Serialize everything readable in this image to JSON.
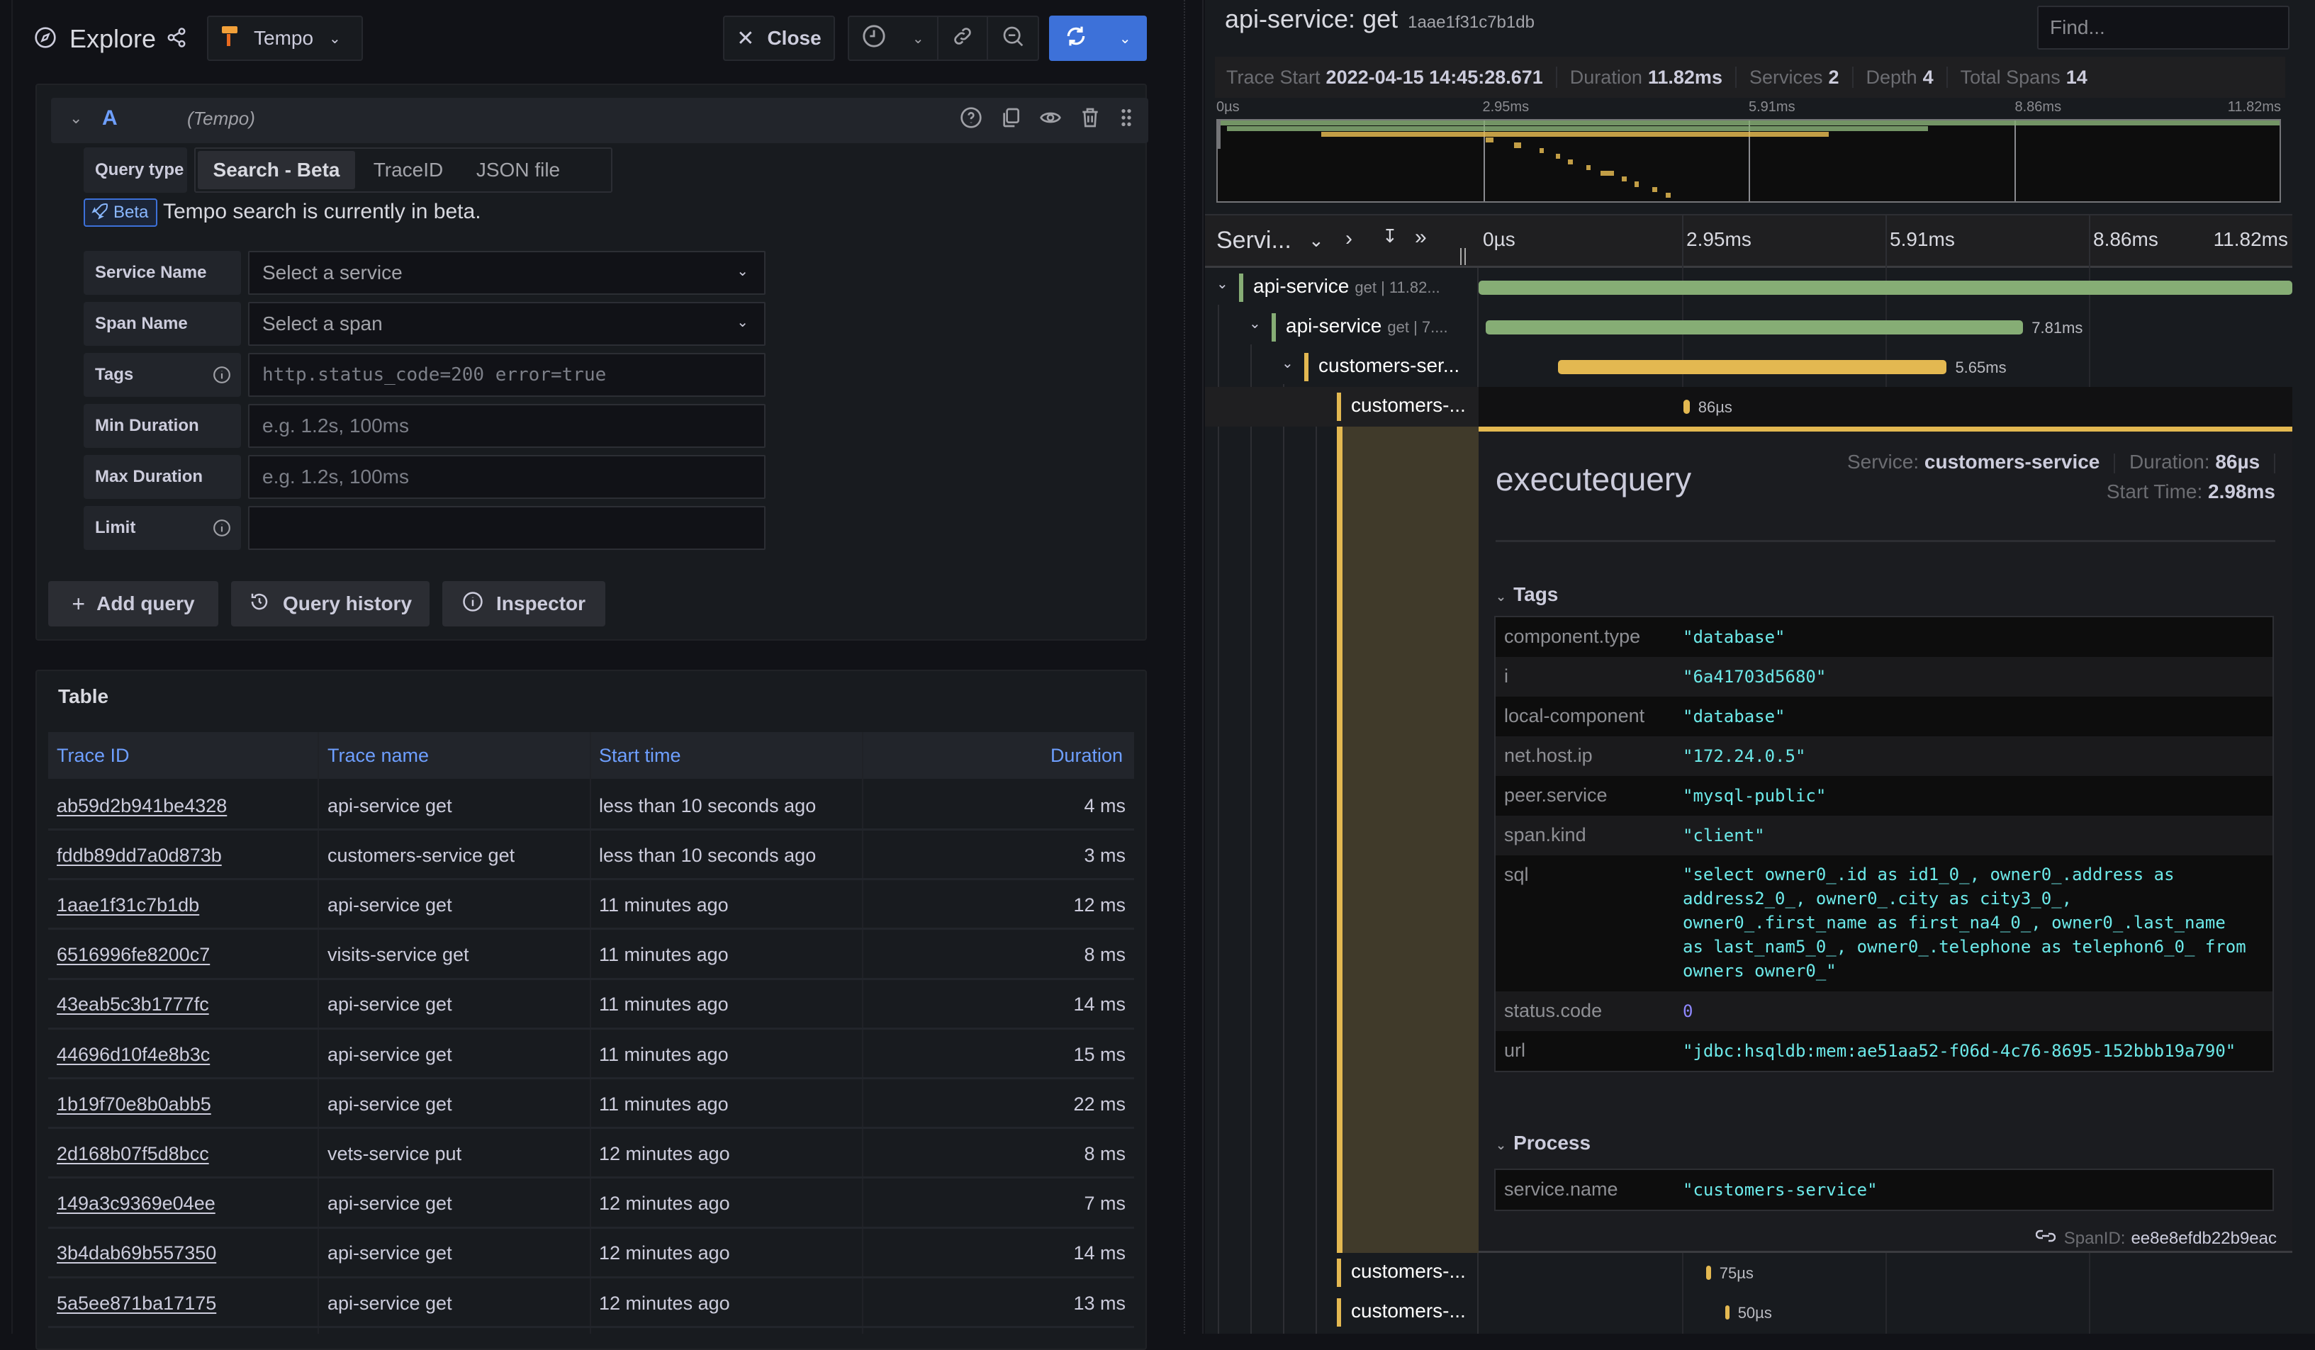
{
  "explore": {
    "title": "Explore",
    "datasource": "Tempo",
    "close_label": "Close",
    "icons": [
      "compass-icon",
      "share-icon",
      "tempo-logo-icon",
      "chevron-down-icon",
      "close-icon",
      "clock-icon",
      "link-icon",
      "zoom-out-icon",
      "refresh-icon"
    ]
  },
  "query": {
    "ref_id": "A",
    "datasource_hint": "(Tempo)",
    "query_type_label": "Query type",
    "query_types": [
      "Search - Beta",
      "TraceID",
      "JSON file"
    ],
    "selected_query_type": "Search - Beta",
    "beta_badge": "Beta",
    "beta_message": "Tempo search is currently in beta.",
    "fields": [
      {
        "label": "Service Name",
        "placeholder": "Select a service",
        "type": "select",
        "info": false
      },
      {
        "label": "Span Name",
        "placeholder": "Select a span",
        "type": "select",
        "info": false
      },
      {
        "label": "Tags",
        "placeholder": "http.status_code=200 error=true",
        "type": "text-mono",
        "info": true
      },
      {
        "label": "Min Duration",
        "placeholder": "e.g. 1.2s, 100ms",
        "type": "text",
        "info": false
      },
      {
        "label": "Max Duration",
        "placeholder": "e.g. 1.2s, 100ms",
        "type": "text",
        "info": false
      },
      {
        "label": "Limit",
        "placeholder": "",
        "type": "text",
        "info": true
      }
    ],
    "actions": [
      "Add query",
      "Query history",
      "Inspector"
    ]
  },
  "table": {
    "title": "Table",
    "columns": [
      "Trace ID",
      "Trace name",
      "Start time",
      "Duration"
    ],
    "rows": [
      [
        "ab59d2b941be4328",
        "api-service get",
        "less than 10 seconds ago",
        "4 ms"
      ],
      [
        "fddb89dd7a0d873b",
        "customers-service get",
        "less than 10 seconds ago",
        "3 ms"
      ],
      [
        "1aae1f31c7b1db",
        "api-service get",
        "11 minutes ago",
        "12 ms"
      ],
      [
        "6516996fe8200c7",
        "visits-service get",
        "11 minutes ago",
        "8 ms"
      ],
      [
        "43eab5c3b1777fc",
        "api-service get",
        "11 minutes ago",
        "14 ms"
      ],
      [
        "44696d10f4e8b3c",
        "api-service get",
        "11 minutes ago",
        "15 ms"
      ],
      [
        "1b19f70e8b0abb5",
        "api-service get",
        "11 minutes ago",
        "22 ms"
      ],
      [
        "2d168b07f5d8bcc",
        "vets-service put",
        "12 minutes ago",
        "8 ms"
      ],
      [
        "149a3c9369e04ee",
        "api-service get",
        "12 minutes ago",
        "7 ms"
      ],
      [
        "3b4dab69b557350",
        "api-service get",
        "12 minutes ago",
        "14 ms"
      ],
      [
        "5a5ee871ba17175",
        "api-service get",
        "12 minutes ago",
        "13 ms"
      ]
    ]
  },
  "trace": {
    "title": "api-service: get",
    "trace_id": "1aae1f31c7b1db",
    "find_placeholder": "Find...",
    "stats": {
      "trace_start_label": "Trace Start",
      "trace_start": "2022-04-15 14:45:28.671",
      "duration_label": "Duration",
      "duration": "11.82ms",
      "services_label": "Services",
      "services": "2",
      "depth_label": "Depth",
      "depth": "4",
      "total_spans_label": "Total Spans",
      "total_spans": "14"
    },
    "ticks": [
      "0µs",
      "2.95ms",
      "5.91ms",
      "8.86ms",
      "11.82ms"
    ],
    "total_ms": 11.82,
    "span_header_label": "Servi...",
    "colors": {
      "api-service": "#86ad75",
      "customers-service": "#e3b851"
    },
    "spans": [
      {
        "service": "api-service",
        "op": "get | 11.82...",
        "depth": 0,
        "start_ms": 0,
        "dur_ms": 11.82,
        "label": "",
        "expanded": true
      },
      {
        "service": "api-service",
        "op": "get | 7....",
        "depth": 1,
        "start_ms": 0.1,
        "dur_ms": 7.81,
        "label": "7.81ms",
        "expanded": true
      },
      {
        "service": "customers-ser...",
        "op": "",
        "depth": 2,
        "start_ms": 1.15,
        "dur_ms": 5.65,
        "label": "5.65ms",
        "expanded": true,
        "color": "customers-service"
      },
      {
        "service": "customers-...",
        "op": "",
        "depth": 3,
        "start_ms": 2.98,
        "dur_ms": 0.086,
        "label": "86µs",
        "selected": true,
        "color": "customers-service"
      },
      {
        "service": "customers-...",
        "op": "",
        "depth": 3,
        "start_ms": 3.3,
        "dur_ms": 0.075,
        "label": "75µs",
        "color": "customers-service"
      },
      {
        "service": "customers-...",
        "op": "",
        "depth": 3,
        "start_ms": 3.58,
        "dur_ms": 0.05,
        "label": "50µs",
        "color": "customers-service"
      }
    ],
    "minimap_spans": [
      {
        "start_ms": 0,
        "dur_ms": 11.82,
        "color": "api-service"
      },
      {
        "start_ms": 0.1,
        "dur_ms": 7.81,
        "color": "api-service"
      },
      {
        "start_ms": 1.15,
        "dur_ms": 5.65,
        "color": "customers-service"
      },
      {
        "start_ms": 2.98,
        "dur_ms": 0.086,
        "color": "customers-service"
      },
      {
        "start_ms": 3.3,
        "dur_ms": 0.075,
        "color": "customers-service"
      },
      {
        "start_ms": 3.58,
        "dur_ms": 0.05,
        "color": "customers-service"
      },
      {
        "start_ms": 3.76,
        "dur_ms": 0.05,
        "color": "customers-service"
      },
      {
        "start_ms": 3.9,
        "dur_ms": 0.05,
        "color": "customers-service"
      },
      {
        "start_ms": 4.1,
        "dur_ms": 0.05,
        "color": "customers-service"
      },
      {
        "start_ms": 4.26,
        "dur_ms": 0.15,
        "color": "customers-service"
      },
      {
        "start_ms": 4.5,
        "dur_ms": 0.05,
        "color": "customers-service"
      },
      {
        "start_ms": 4.64,
        "dur_ms": 0.05,
        "color": "customers-service"
      },
      {
        "start_ms": 4.84,
        "dur_ms": 0.05,
        "color": "customers-service"
      },
      {
        "start_ms": 4.99,
        "dur_ms": 0.05,
        "color": "customers-service"
      }
    ],
    "detail": {
      "operation": "executequery",
      "service_label": "Service:",
      "service": "customers-service",
      "duration_label": "Duration:",
      "duration": "86µs",
      "start_label": "Start Time:",
      "start": "2.98ms",
      "tags_title": "Tags",
      "tags": [
        {
          "key": "component.type",
          "value": "\"database\""
        },
        {
          "key": "i",
          "value": "\"6a41703d5680\""
        },
        {
          "key": "local-component",
          "value": "\"database\""
        },
        {
          "key": "net.host.ip",
          "value": "\"172.24.0.5\""
        },
        {
          "key": "peer.service",
          "value": "\"mysql-public\""
        },
        {
          "key": "span.kind",
          "value": "\"client\""
        },
        {
          "key": "sql",
          "value": "\"select owner0_.id as id1_0_, owner0_.address as address2_0_, owner0_.city as city3_0_, owner0_.first_name as first_na4_0_, owner0_.last_name as last_nam5_0_, owner0_.telephone as telephon6_0_ from owners owner0_\""
        },
        {
          "key": "status.code",
          "value": "0",
          "numeric": true
        },
        {
          "key": "url",
          "value": "\"jdbc:hsqldb:mem:ae51aa52-f06d-4c76-8695-152bbb19a790\""
        }
      ],
      "process_title": "Process",
      "process": [
        {
          "key": "service.name",
          "value": "\"customers-service\""
        }
      ],
      "span_id_label": "SpanID:",
      "span_id": "ee8e8efdb22b9eac"
    }
  }
}
